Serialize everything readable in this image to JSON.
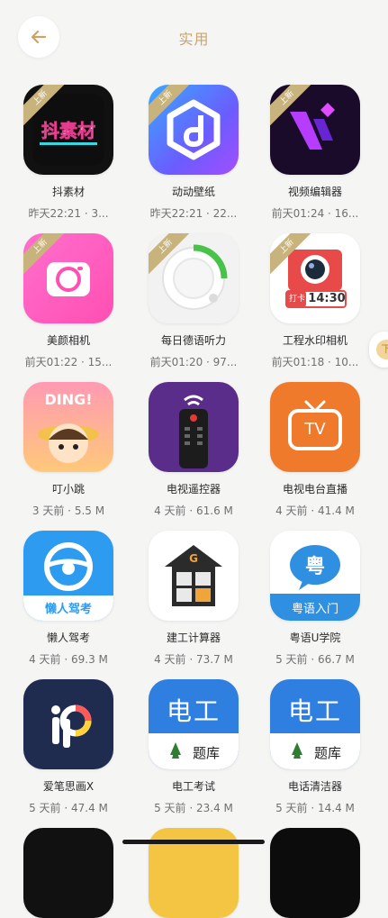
{
  "header": {
    "title": "实用",
    "back_icon": "back-arrow-icon"
  },
  "ribbon_label": "上新",
  "side_handle_label": "下",
  "apps": [
    {
      "name": "抖素材",
      "meta": "昨天22:21 · 3...",
      "is_new": true,
      "icon": "douyin-material-icon"
    },
    {
      "name": "动动壁纸",
      "meta": "昨天22:21 · 22...",
      "is_new": true,
      "icon": "wallpaper-icon"
    },
    {
      "name": "视频编辑器",
      "meta": "前天01:24 · 16...",
      "is_new": true,
      "icon": "video-editor-icon"
    },
    {
      "name": "美颜相机",
      "meta": "前天01:22 · 15...",
      "is_new": true,
      "icon": "beauty-camera-icon"
    },
    {
      "name": "每日德语听力",
      "meta": "前天01:20 · 97...",
      "is_new": true,
      "icon": "german-listening-icon"
    },
    {
      "name": "工程水印相机",
      "meta": "前天01:18 · 10...",
      "is_new": true,
      "icon": "watermark-camera-icon",
      "badge_text": "打卡",
      "time_text": "14:30"
    },
    {
      "name": "叮小跳",
      "meta": "3 天前 · 5.5 M",
      "is_new": false,
      "icon": "dingxiaotiao-icon",
      "badge_text": "DING!"
    },
    {
      "name": "电视遥控器",
      "meta": "4 天前 · 61.6 M",
      "is_new": false,
      "icon": "tv-remote-icon"
    },
    {
      "name": "电视电台直播",
      "meta": "4 天前 · 41.4 M",
      "is_new": false,
      "icon": "tv-live-icon",
      "badge_text": "TV"
    },
    {
      "name": "懒人驾考",
      "meta": "4 天前 · 69.3 M",
      "is_new": false,
      "icon": "driving-test-icon",
      "badge_text": "懒人驾考"
    },
    {
      "name": "建工计算器",
      "meta": "4 天前 · 73.7 M",
      "is_new": false,
      "icon": "construction-calculator-icon",
      "badge_text": "G"
    },
    {
      "name": "粤语U学院",
      "meta": "5 天前 · 66.7 M",
      "is_new": false,
      "icon": "cantonese-icon",
      "badge_text": "粤",
      "sub_text": "粤语入门"
    },
    {
      "name": "爱笔思画X",
      "meta": "5 天前 · 47.4 M",
      "is_new": false,
      "icon": "ibis-paint-icon"
    },
    {
      "name": "电工考试",
      "meta": "5 天前 · 23.4 M",
      "is_new": false,
      "icon": "electrician-exam-icon",
      "badge_text": "电工",
      "sub_text": "题库"
    },
    {
      "name": "电话清洁器",
      "meta": "5 天前 · 14.4 M",
      "is_new": false,
      "icon": "phone-cleaner-icon",
      "badge_text": "电工",
      "sub_text": "题库"
    }
  ]
}
